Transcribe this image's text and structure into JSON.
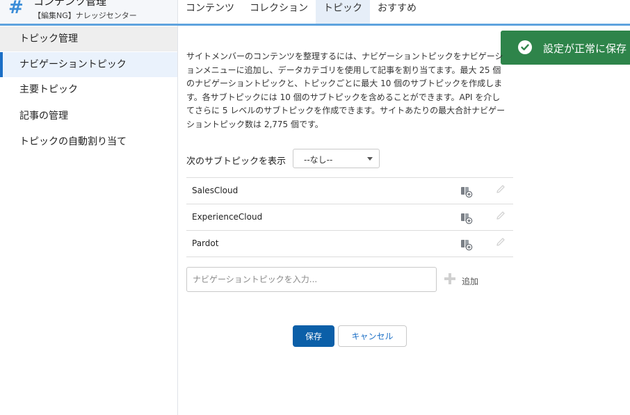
{
  "header": {
    "title": "コンテンツ管理",
    "subtitle": "【編集NG】ナレッジセンター",
    "logo_icon": "hash-icon",
    "tabs": [
      {
        "label": "コンテンツ"
      },
      {
        "label": "コレクション"
      },
      {
        "label": "トピック",
        "active": true
      },
      {
        "label": "おすすめ"
      }
    ]
  },
  "sidebar": {
    "items": [
      {
        "label": "トピック管理",
        "type": "section"
      },
      {
        "label": "ナビゲーショントピック",
        "active": true
      },
      {
        "label": "主要トピック"
      },
      {
        "label": "記事の管理"
      },
      {
        "label": "トピックの自動割り当て"
      }
    ]
  },
  "toast": {
    "message": "設定が正常に保存",
    "icon": "success-check-icon",
    "color": "#2e844a"
  },
  "main": {
    "description": "サイトメンバーのコンテンツを整理するには、ナビゲーショントピックをナビゲーションメニューに追加し、データカテゴリを使用して記事を割り当てます。最大 25 個のナビゲーショントピックと、トピックごとに最大 10 個のサブトピックを作成します。各サブトピックには 10 個のサブトピックを含めることができます。API を介してさらに 5 レベルのサブトピックを作成できます。サイトあたりの最大合計ナビゲーショントピック数は 2,775 個です。",
    "subtopic_label": "次のサブトピックを表示",
    "subtopic_select_value": "--なし--",
    "topics": [
      {
        "name": "SalesCloud",
        "icons": [
          "book-add-icon",
          "pencil-icon"
        ]
      },
      {
        "name": "ExperienceCloud",
        "icons": [
          "book-add-icon",
          "pencil-icon"
        ]
      },
      {
        "name": "Pardot",
        "icons": [
          "book-add-icon",
          "pencil-icon"
        ]
      }
    ],
    "new_topic_placeholder": "ナビゲーショントピックを入力...",
    "add_label": "追加",
    "save_label": "保存",
    "cancel_label": "キャンセル"
  },
  "colors": {
    "accent": "#1b6fc6",
    "header_rule": "#5ea3de",
    "primary_button": "#0b5fa8",
    "toast": "#2e844a"
  }
}
